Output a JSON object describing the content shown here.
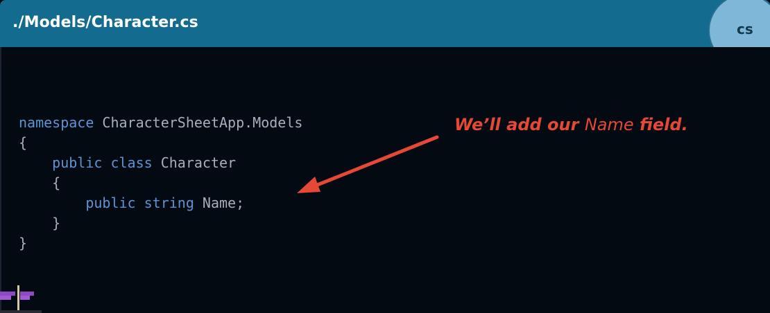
{
  "header": {
    "title": "./Models/Character.cs",
    "language": "cs"
  },
  "code": {
    "lines": [
      "namespace CharacterSheetApp.Models",
      "{",
      "    public class Character",
      "    {",
      "        public string Name;",
      "    }",
      "}"
    ]
  },
  "annotation": {
    "part1": "We’ll add our ",
    "name": "Name",
    "part2": " field."
  },
  "colors": {
    "header": "#136c8f",
    "background": "#050a12",
    "keyword": "#5f93d4",
    "text": "#a5afbd",
    "annotation": "#e54837",
    "badge": "#7eb7d7"
  },
  "icons": {
    "arrow": "red-arrow-icon",
    "flags": "purple-flags-icon"
  }
}
